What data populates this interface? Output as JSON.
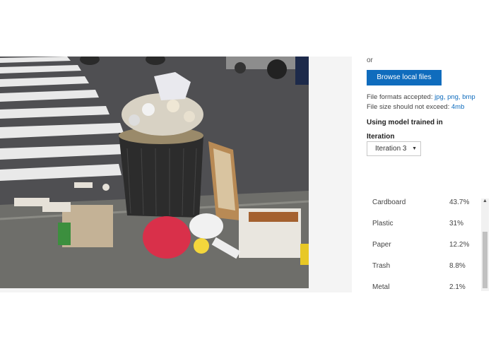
{
  "upload": {
    "or_text": "or",
    "browse_label": "Browse local files",
    "formats_prefix": "File formats accepted: ",
    "formats_value": "jpg, png, bmp",
    "size_prefix": "File size should not exceed: ",
    "size_value": "4mb"
  },
  "model": {
    "heading": "Using model trained in",
    "iteration_label": "Iteration",
    "iteration_selected": "Iteration 3"
  },
  "predictions": [
    {
      "tag": "Cardboard",
      "probability": "43.7%"
    },
    {
      "tag": "Plastic",
      "probability": "31%"
    },
    {
      "tag": "Paper",
      "probability": "12.2%"
    },
    {
      "tag": "Trash",
      "probability": "8.8%"
    },
    {
      "tag": "Metal",
      "probability": "2.1%"
    }
  ],
  "colors": {
    "accent": "#0f6cbd"
  },
  "icons": {
    "select_chevron": "chevron-down-icon",
    "scroll_up": "chevron-up-icon"
  }
}
